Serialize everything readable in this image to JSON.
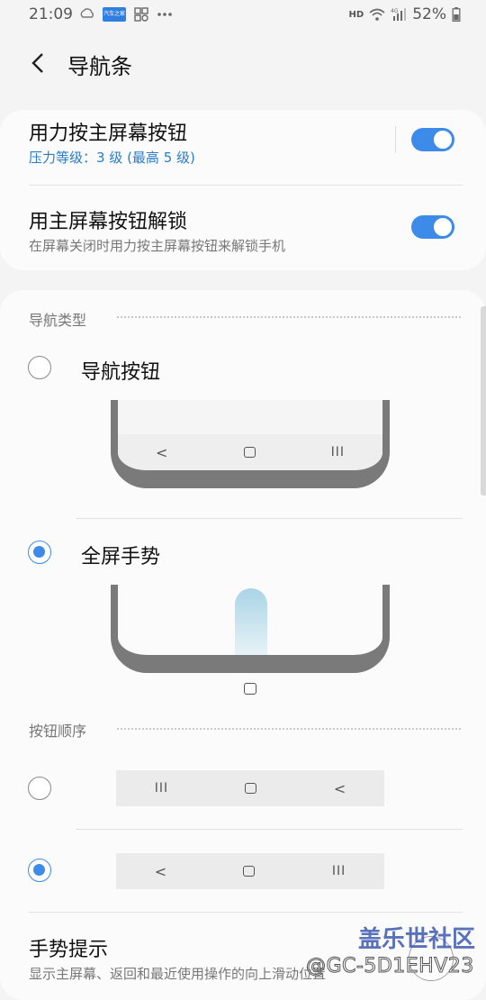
{
  "status_bar": {
    "time": "21:09",
    "left_icons": [
      "cloud-icon",
      "app-badge-icon",
      "grid-app-icon",
      "more-icon"
    ],
    "app_badge_text": "汽车之家",
    "hd": "HD",
    "network": "4G",
    "battery": "52%"
  },
  "header": {
    "title": "导航条"
  },
  "card1": {
    "row1": {
      "title": "用力按主屏幕按钮",
      "subtitle": "压力等级：3 级 (最高 5 级)",
      "toggle_on": true
    },
    "row2": {
      "title": "用主屏幕按钮解锁",
      "subtitle": "在屏幕关闭时用力按主屏幕按钮来解锁手机",
      "toggle_on": true
    }
  },
  "nav_type": {
    "label": "导航类型",
    "options": [
      {
        "label": "导航按钮",
        "selected": false,
        "preview_buttons": [
          "<",
          "○",
          "III"
        ]
      },
      {
        "label": "全屏手势",
        "selected": true
      }
    ]
  },
  "button_order": {
    "label": "按钮顺序",
    "options": [
      {
        "selected": false,
        "buttons": [
          "III",
          "○",
          "<"
        ]
      },
      {
        "selected": true,
        "buttons": [
          "<",
          "○",
          "III"
        ]
      }
    ]
  },
  "gesture_hint": {
    "title": "手势提示",
    "subtitle": "显示主屏幕、返回和最近使用操作的向上滑动位置"
  },
  "watermark": {
    "site": "盖乐世社区",
    "user": "@GC-5D1EHV23"
  },
  "colors": {
    "accent": "#3d8be8",
    "blue_text": "#2a7cc7",
    "background": "#f4f4f4",
    "card": "#fbfbfb"
  }
}
